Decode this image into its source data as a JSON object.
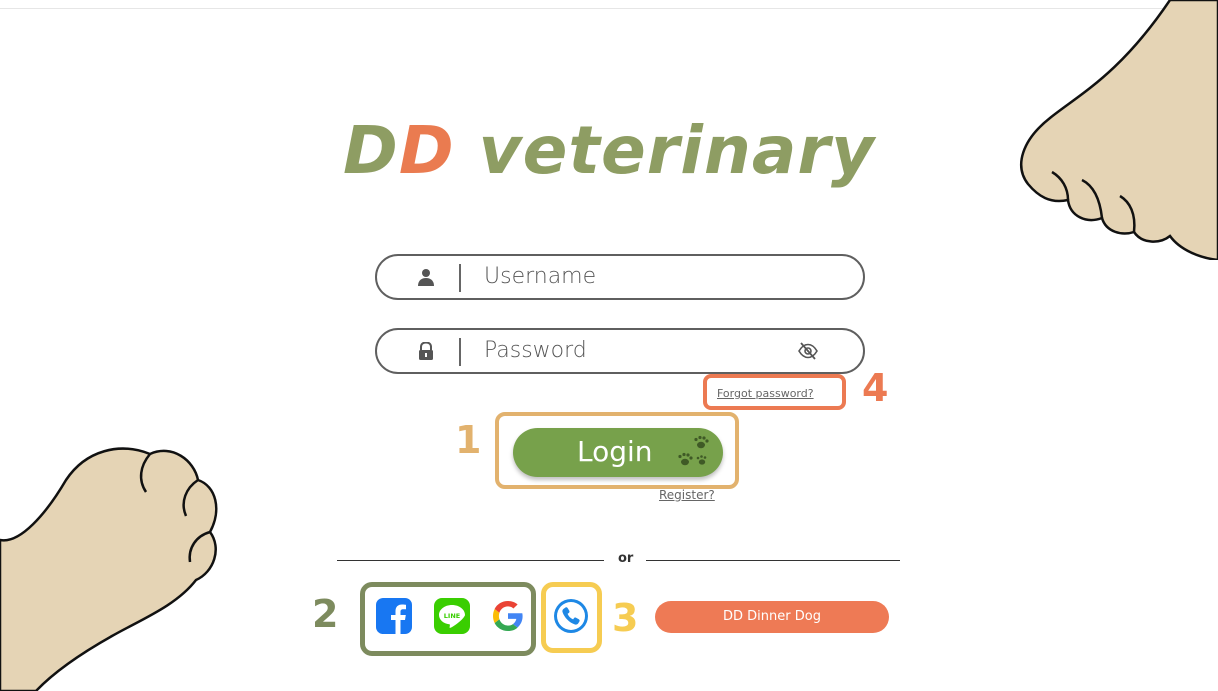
{
  "app": {
    "title_part1": "D",
    "title_part2": "D",
    "title_part3": " veterinary"
  },
  "form": {
    "username": {
      "placeholder": "Username",
      "icon": "user-icon"
    },
    "password": {
      "placeholder": "Password",
      "icon": "lock-icon",
      "toggle_icon": "eye-slash-icon"
    },
    "forgot_password": "Forgot password?",
    "login_label": "Login",
    "register": "Register?",
    "separator": "or",
    "dd_button": "DD Dinner Dog"
  },
  "social": [
    {
      "name": "facebook",
      "icon": "facebook-icon",
      "color": "#1877f2"
    },
    {
      "name": "line",
      "icon": "line-icon",
      "color": "#3ace01"
    },
    {
      "name": "google",
      "icon": "google-icon"
    },
    {
      "name": "phone",
      "icon": "phone-icon",
      "color": "#1e88e5"
    }
  ],
  "annotations": [
    {
      "number": "1",
      "color": "#e2b26e"
    },
    {
      "number": "2",
      "color": "#7d8b5e"
    },
    {
      "number": "3",
      "color": "#f6cc52"
    },
    {
      "number": "4",
      "color": "#ec7a52"
    }
  ],
  "colors": {
    "title_green": "#8e9d63",
    "title_orange": "#ea7b50",
    "login_green": "#77a14b",
    "paw": "#e5d4b5"
  }
}
